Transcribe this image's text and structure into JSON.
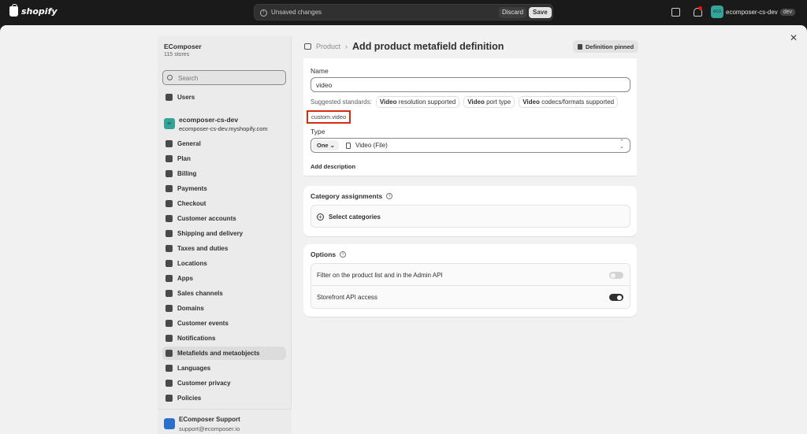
{
  "topbar": {
    "brand": "shopify",
    "unsaved_text": "Unsaved changes",
    "discard_label": "Discard",
    "save_label": "Save",
    "account_initials": "eco",
    "account_name": "ecomposer-cs-dev",
    "account_badge": "dev"
  },
  "sidebar": {
    "org_name": "EComposer",
    "org_sub": "115 stores",
    "search_placeholder": "Search",
    "users_label": "Users",
    "store_initials": "ec",
    "store_name": "ecomposer-cs-dev",
    "store_domain": "ecomposer-cs-dev.myshopify.com",
    "items": [
      {
        "label": "General",
        "icon": "gear-icon"
      },
      {
        "label": "Plan",
        "icon": "plan-icon"
      },
      {
        "label": "Billing",
        "icon": "billing-icon"
      },
      {
        "label": "Payments",
        "icon": "payments-icon"
      },
      {
        "label": "Checkout",
        "icon": "cart-icon"
      },
      {
        "label": "Customer accounts",
        "icon": "person-icon"
      },
      {
        "label": "Shipping and delivery",
        "icon": "truck-icon"
      },
      {
        "label": "Taxes and duties",
        "icon": "tax-icon"
      },
      {
        "label": "Locations",
        "icon": "location-icon"
      },
      {
        "label": "Apps",
        "icon": "apps-icon"
      },
      {
        "label": "Sales channels",
        "icon": "channels-icon"
      },
      {
        "label": "Domains",
        "icon": "globe-icon"
      },
      {
        "label": "Customer events",
        "icon": "events-icon"
      },
      {
        "label": "Notifications",
        "icon": "bell-icon"
      },
      {
        "label": "Metafields and metaobjects",
        "icon": "metafields-icon"
      },
      {
        "label": "Languages",
        "icon": "language-icon"
      },
      {
        "label": "Customer privacy",
        "icon": "lock-icon"
      },
      {
        "label": "Policies",
        "icon": "policies-icon"
      }
    ],
    "active_index": 14,
    "support_name": "EComposer Support",
    "support_email": "support@ecomposer.io"
  },
  "header": {
    "breadcrumb": "Product",
    "title": "Add product metafield definition",
    "pinned_label": "Definition pinned"
  },
  "form": {
    "name_label": "Name",
    "name_value": "video",
    "suggested_label": "Suggested standards:",
    "suggestions": [
      {
        "bold": "Video",
        "rest": " resolution supported"
      },
      {
        "bold": "Video",
        "rest": " port type"
      },
      {
        "bold": "Video",
        "rest": " codecs/formats supported"
      }
    ],
    "namespace_key": "custom.video",
    "type_label": "Type",
    "type_count": "One",
    "type_value": "Video (File)",
    "add_description": "Add description"
  },
  "category": {
    "title": "Category assignments",
    "select_label": "Select categories"
  },
  "options": {
    "title": "Options",
    "rows": [
      {
        "label": "Filter on the product list and in the Admin API",
        "on": false
      },
      {
        "label": "Storefront API access",
        "on": true
      }
    ]
  }
}
